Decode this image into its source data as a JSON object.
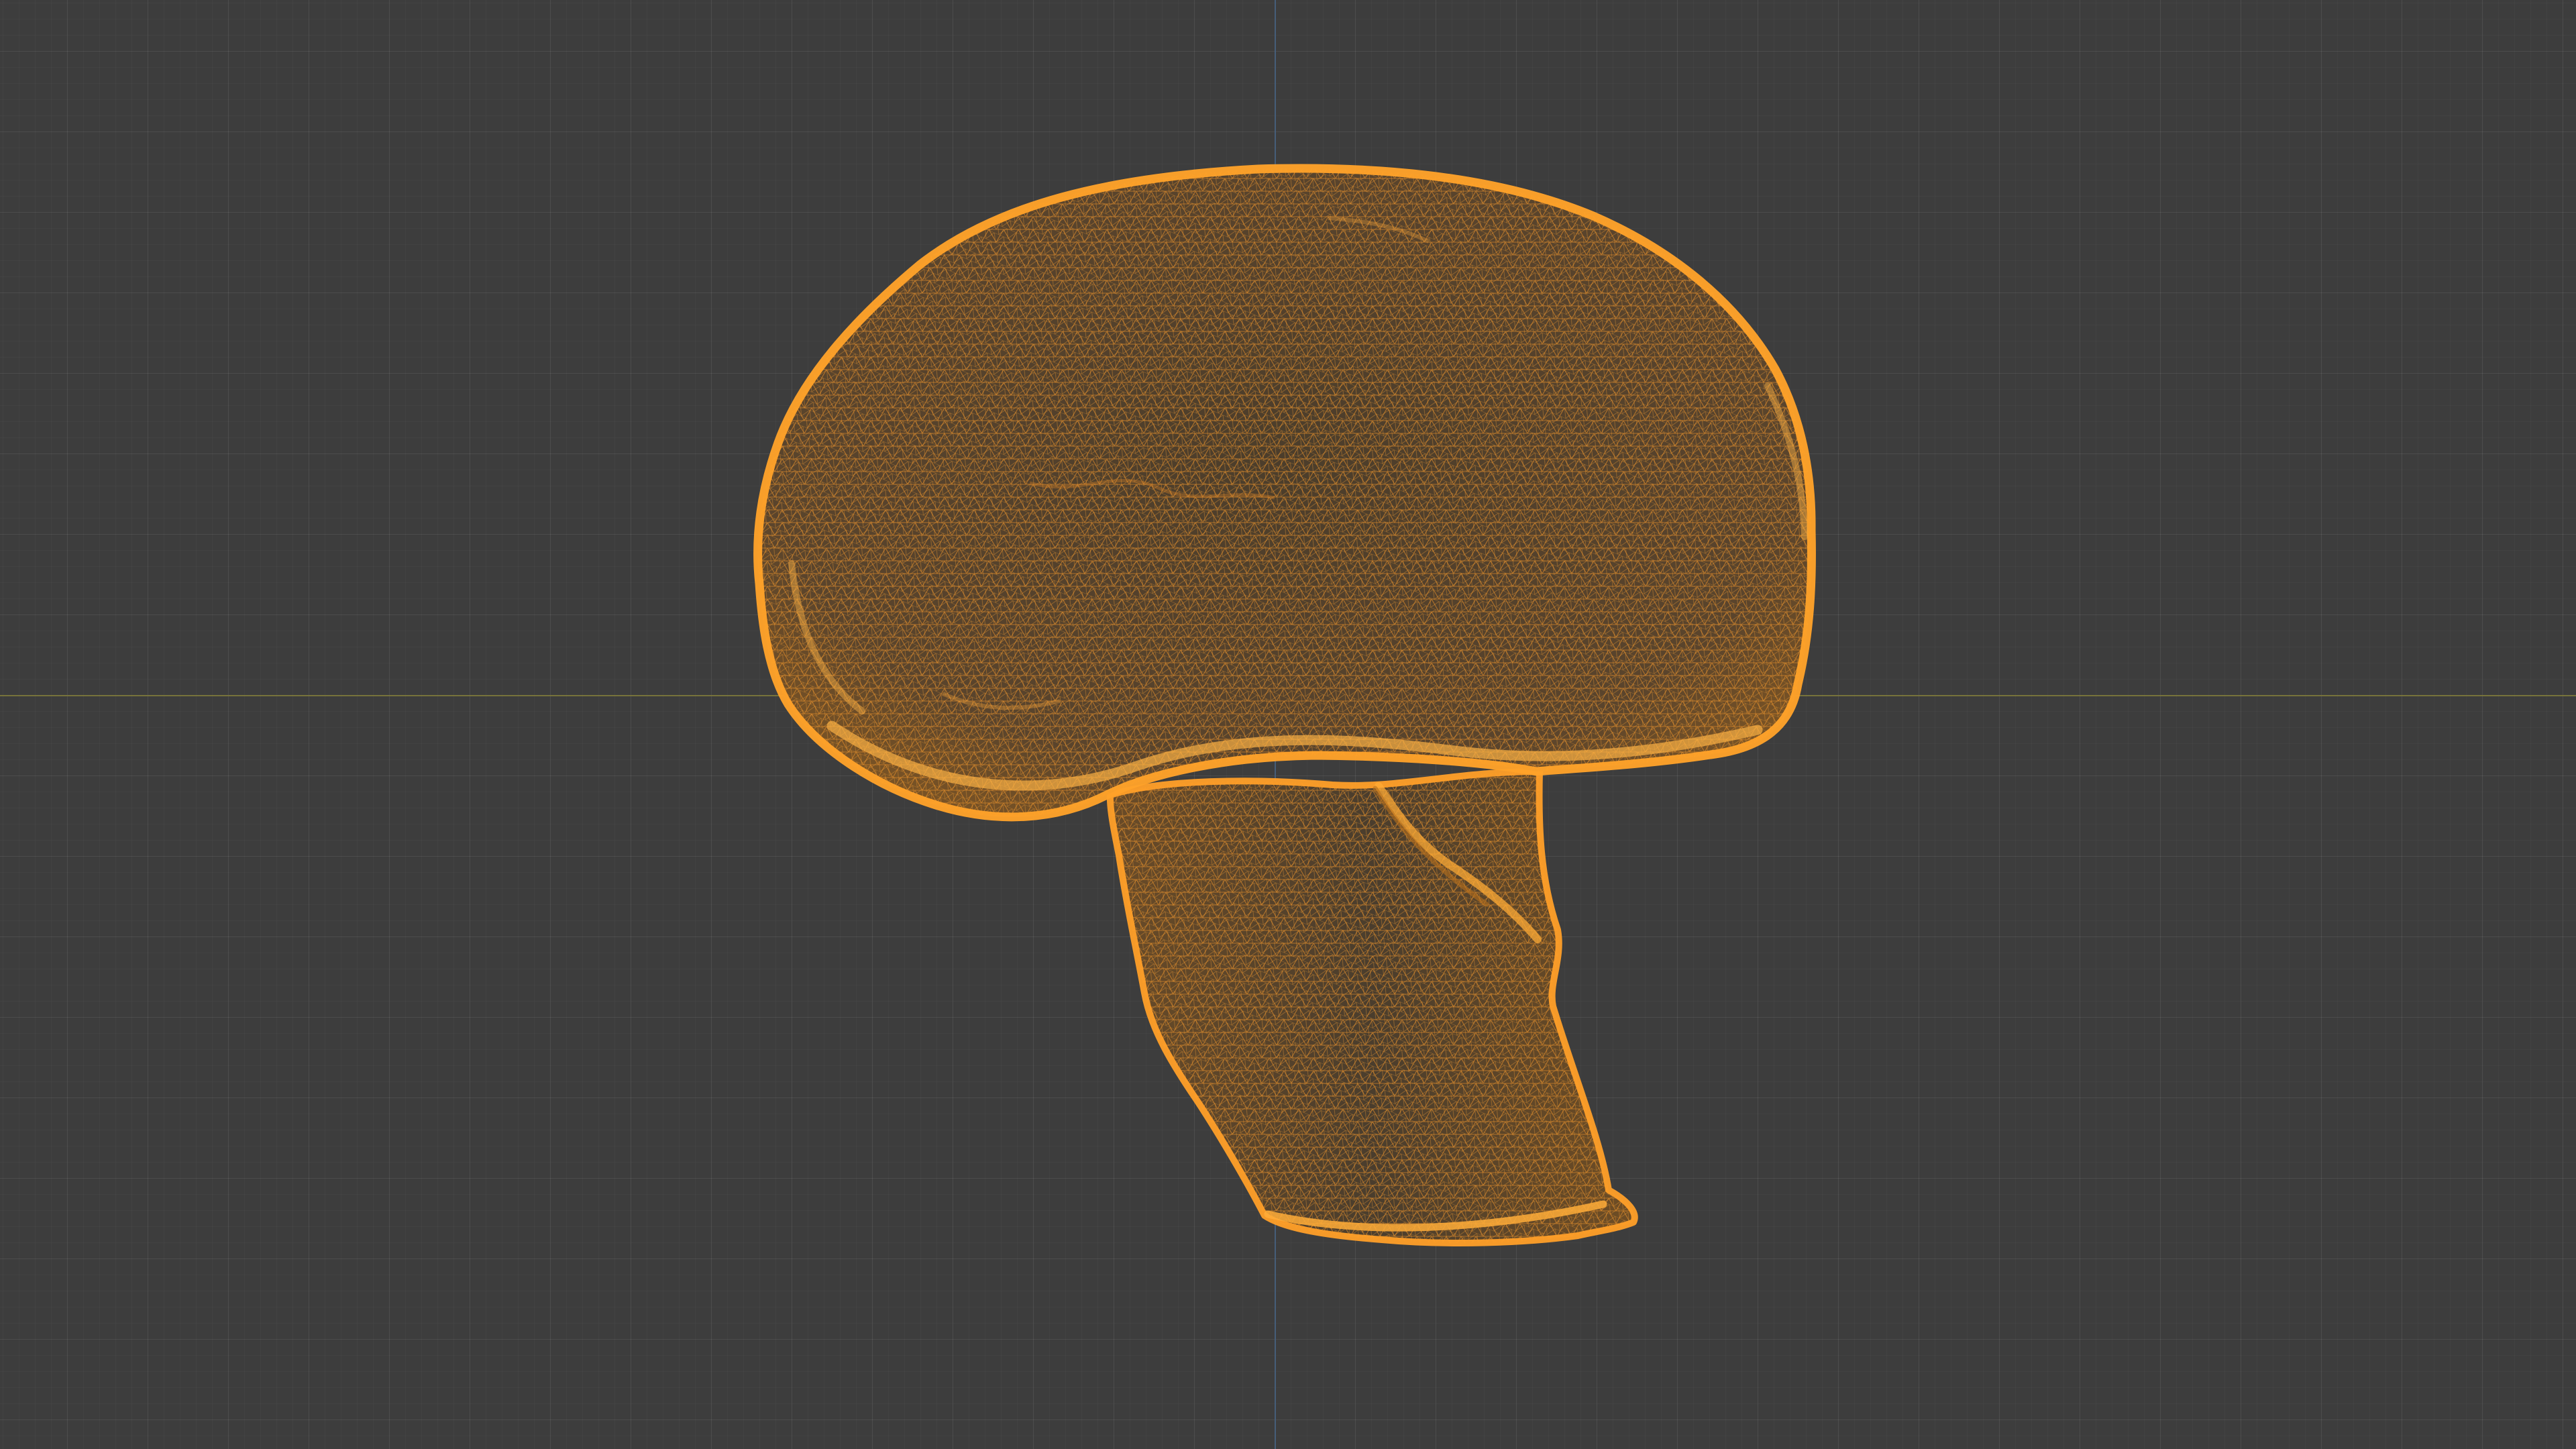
{
  "viewport": {
    "background_color": "#3d3d3d",
    "grid_color": "#4a4a4a",
    "x_axis_color": "#7f7a3a",
    "y_axis_color": "#46607f"
  },
  "object": {
    "type": "mushroom-wireframe-mesh",
    "selected": true,
    "wire_color": "#f0952b",
    "fill_color": "#57452d"
  }
}
